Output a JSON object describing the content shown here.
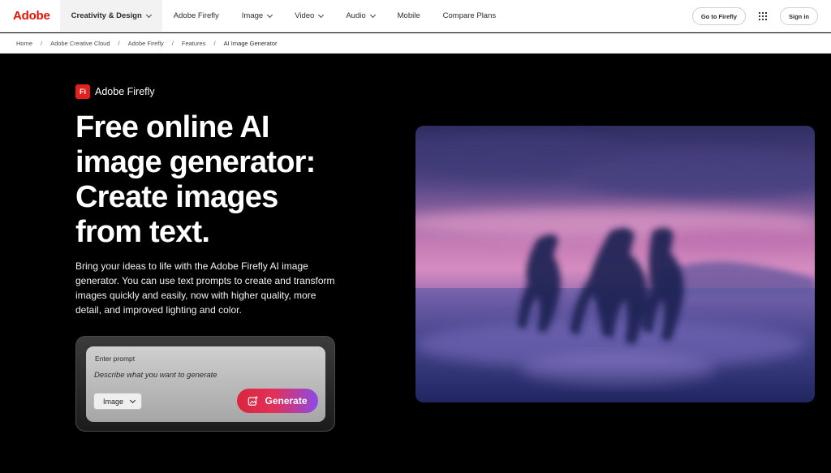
{
  "nav": {
    "brand": "Adobe",
    "items": [
      {
        "label": "Creativity & Design",
        "dropdown": true,
        "active": true
      },
      {
        "label": "Adobe Firefly",
        "dropdown": false,
        "active": false
      },
      {
        "label": "Image",
        "dropdown": true,
        "active": false
      },
      {
        "label": "Video",
        "dropdown": true,
        "active": false
      },
      {
        "label": "Audio",
        "dropdown": true,
        "active": false
      },
      {
        "label": "Mobile",
        "dropdown": false,
        "active": false
      },
      {
        "label": "Compare Plans",
        "dropdown": false,
        "active": false
      }
    ],
    "goto_label": "Go to Firefly",
    "apps_icon": "app-grid-icon",
    "signin_label": "Sign in"
  },
  "breadcrumb": [
    "Home",
    "Adobe Creative Cloud",
    "Adobe Firefly",
    "Features",
    "AI Image Generator"
  ],
  "hero": {
    "product_logo_text": "Fi",
    "product_name": "Adobe Firefly",
    "headline": "Free online AI image generator: Create images from text.",
    "body": "Bring your ideas to life with the Adobe Firefly AI image generator. You can use text prompts to create and transform images quickly and easily, now with higher quality, more detail, and improved lighting and color.",
    "prompt": {
      "label": "Enter prompt",
      "placeholder": "Describe what you want to generate",
      "value": "",
      "type_select": "Image",
      "generate_label": "Generate",
      "generate_icon": "sparkle-image-icon"
    }
  },
  "colors": {
    "brand_red": "#eb1000",
    "firefly_red": "#e2211c",
    "generate_gradient_start": "#d9263e",
    "generate_gradient_end": "#8c4be6",
    "hero_bg": "#000000"
  }
}
